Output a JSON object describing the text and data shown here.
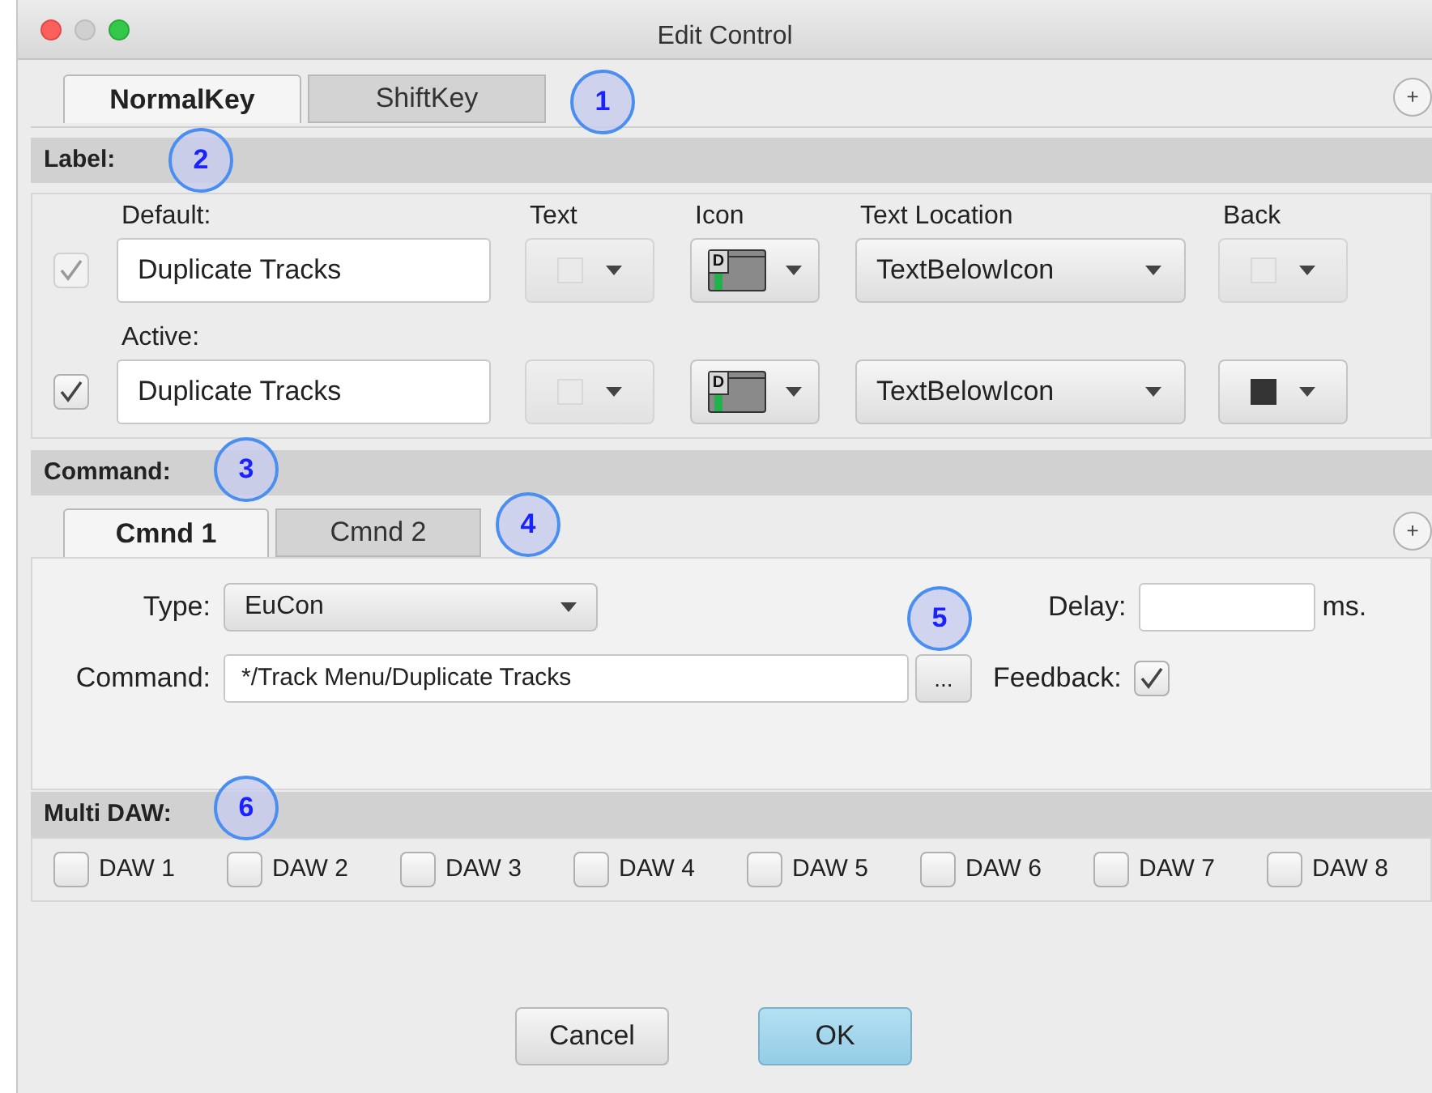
{
  "window": {
    "title": "Edit Control"
  },
  "key_tabs": [
    {
      "label": "NormalKey",
      "selected": true
    },
    {
      "label": "ShiftKey",
      "selected": false
    }
  ],
  "key_tabs_add": "+",
  "label_section": {
    "title": "Label:",
    "columns": [
      "Text",
      "Icon",
      "Text Location",
      "Back"
    ],
    "rows": [
      {
        "caption": "Default:",
        "checked": true,
        "disabled": true,
        "value": "Duplicate Tracks",
        "text_swatch": {
          "disabled": true
        },
        "icon_letter": "D",
        "text_location": "TextBelowIcon",
        "back_swatch": {
          "disabled": true
        }
      },
      {
        "caption": "Active:",
        "checked": true,
        "disabled": false,
        "value": "Duplicate Tracks",
        "text_swatch": {
          "disabled": true
        },
        "icon_letter": "D",
        "text_location": "TextBelowIcon",
        "back_swatch": {
          "disabled": false,
          "color": "#333333"
        }
      }
    ]
  },
  "command_section": {
    "title": "Command:",
    "tabs": [
      {
        "label": "Cmnd 1",
        "selected": true
      },
      {
        "label": "Cmnd 2",
        "selected": false
      }
    ],
    "add": "+",
    "type_label": "Type:",
    "type_value": "EuCon",
    "delay_label": "Delay:",
    "delay_unit": "ms.",
    "command_label": "Command:",
    "command_value": "*/Track Menu/Duplicate Tracks",
    "browse_button": "...",
    "feedback_label": "Feedback:",
    "feedback_checked": true
  },
  "multi_daw": {
    "title": "Multi DAW:",
    "items": [
      {
        "label": "DAW 1",
        "checked": false
      },
      {
        "label": "DAW 2",
        "checked": false
      },
      {
        "label": "DAW 3",
        "checked": false
      },
      {
        "label": "DAW 4",
        "checked": false
      },
      {
        "label": "DAW 5",
        "checked": false
      },
      {
        "label": "DAW 6",
        "checked": false
      },
      {
        "label": "DAW 7",
        "checked": false
      },
      {
        "label": "DAW 8",
        "checked": false
      }
    ]
  },
  "buttons": [
    {
      "label": "Cancel",
      "default": false
    },
    {
      "label": "OK",
      "default": true
    }
  ],
  "callouts": [
    "1",
    "2",
    "3",
    "4",
    "5",
    "6"
  ]
}
